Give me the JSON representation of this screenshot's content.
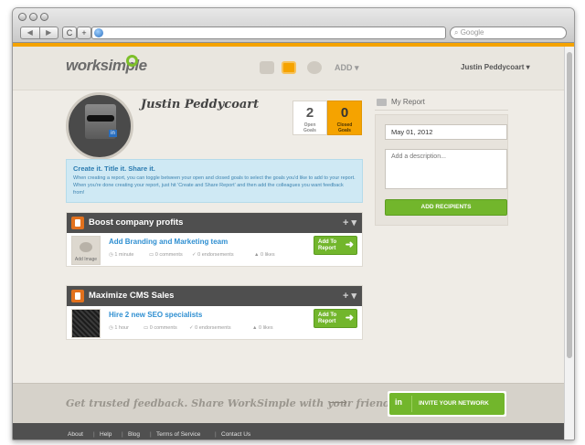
{
  "browser": {
    "nav_back": "◀",
    "nav_forward": "▶",
    "reload": "C",
    "add_tab": "+",
    "search_placeholder": "Google"
  },
  "header": {
    "logo": "worksimple",
    "add_menu": "ADD ▾",
    "user_menu": "Justin Peddycoart ▾"
  },
  "profile": {
    "name": "Justin Peddycoart",
    "open_goals": {
      "count": "2",
      "label_line1": "Open",
      "label_line2": "Goals"
    },
    "closed_goals": {
      "count": "0",
      "label_line1": "Closed",
      "label_line2": "Goals"
    }
  },
  "info": {
    "title": "Create it. Title it. Share it.",
    "text": "When creating a report, you can toggle between your open and closed goals to select the goals you'd like to add to your report. When you're done creating your report, just hit 'Create and Share Report' and then add the colleagues you want feedback from!"
  },
  "goals": [
    {
      "title": "Boost company profits",
      "plus": "+ ▾",
      "item": {
        "title": "Add Branding and Marketing team",
        "thumb_label": "Add Image",
        "time": "1 minute",
        "comments": "0 comments",
        "endorsements": "0 endorsements",
        "likes": "0 likes",
        "add_button_line1": "Add To",
        "add_button_line2": "Report"
      }
    },
    {
      "title": "Maximize CMS Sales",
      "plus": "+ ▾",
      "item": {
        "title": "Hire 2 new SEO specialists",
        "time": "1 hour",
        "comments": "0 comments",
        "endorsements": "0 endorsements",
        "likes": "0 likes",
        "add_button_line1": "Add To",
        "add_button_line2": "Report"
      }
    }
  ],
  "report": {
    "title": "My Report",
    "date_value": "May 01, 2012",
    "description_placeholder": "Add a description...",
    "add_recipients": "ADD RECIPIENTS"
  },
  "promo": {
    "text": "Get trusted feedback. Share WorkSimple with your friends!",
    "invite_icon": "in",
    "invite_label": "INVITE YOUR NETWORK"
  },
  "footer": {
    "links": [
      "About",
      "Help",
      "Blog",
      "Terms of Service",
      "Contact Us"
    ],
    "separator": "|"
  },
  "colors": {
    "accent_orange": "#f5a300",
    "brand_green": "#72b62c",
    "link_blue": "#2f8fd1",
    "goal_header": "#4f4f4f"
  }
}
